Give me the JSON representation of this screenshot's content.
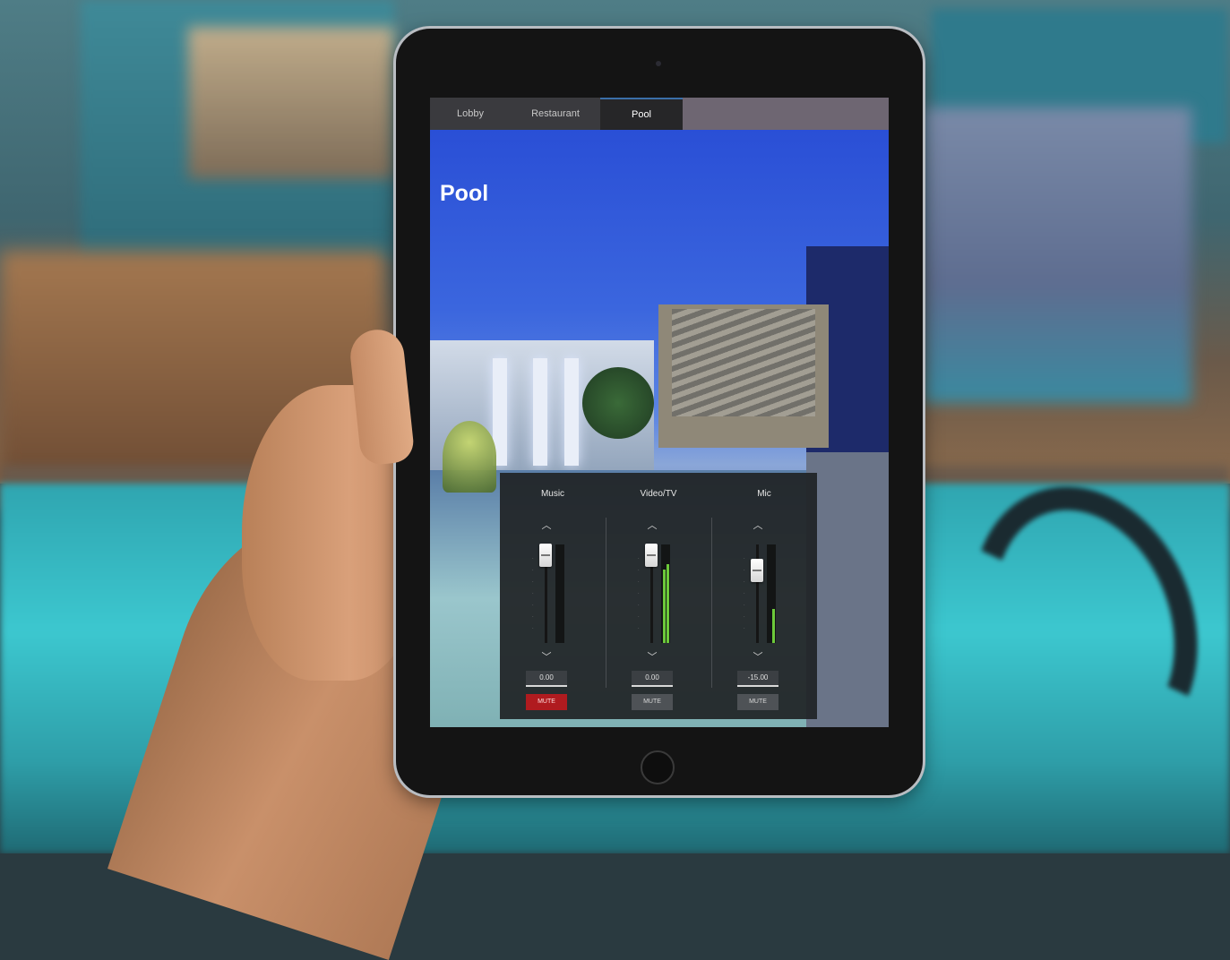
{
  "tabs": [
    {
      "label": "Lobby",
      "active": false
    },
    {
      "label": "Restaurant",
      "active": false
    },
    {
      "label": "Pool",
      "active": true
    }
  ],
  "page": {
    "title": "Pool"
  },
  "mixer": {
    "channels": [
      {
        "name": "Music",
        "value": "0.00",
        "mute_label": "MUTE",
        "muted": true,
        "fader_level": 0.92,
        "meter_left": 0.0,
        "meter_right": 0.0
      },
      {
        "name": "Video/TV",
        "value": "0.00",
        "mute_label": "MUTE",
        "muted": false,
        "fader_level": 0.92,
        "meter_left": 0.75,
        "meter_right": 0.8
      },
      {
        "name": "Mic",
        "value": "-15.00",
        "mute_label": "MUTE",
        "muted": false,
        "fader_level": 0.72,
        "meter_left": 0.0,
        "meter_right": 0.35
      }
    ]
  },
  "colors": {
    "mute_active": "#b01b1f",
    "meter": "#6cc93a",
    "tab_active_indicator": "#3a6ea8"
  },
  "icons": {
    "up": "chevron-up-icon",
    "down": "chevron-down-icon"
  }
}
